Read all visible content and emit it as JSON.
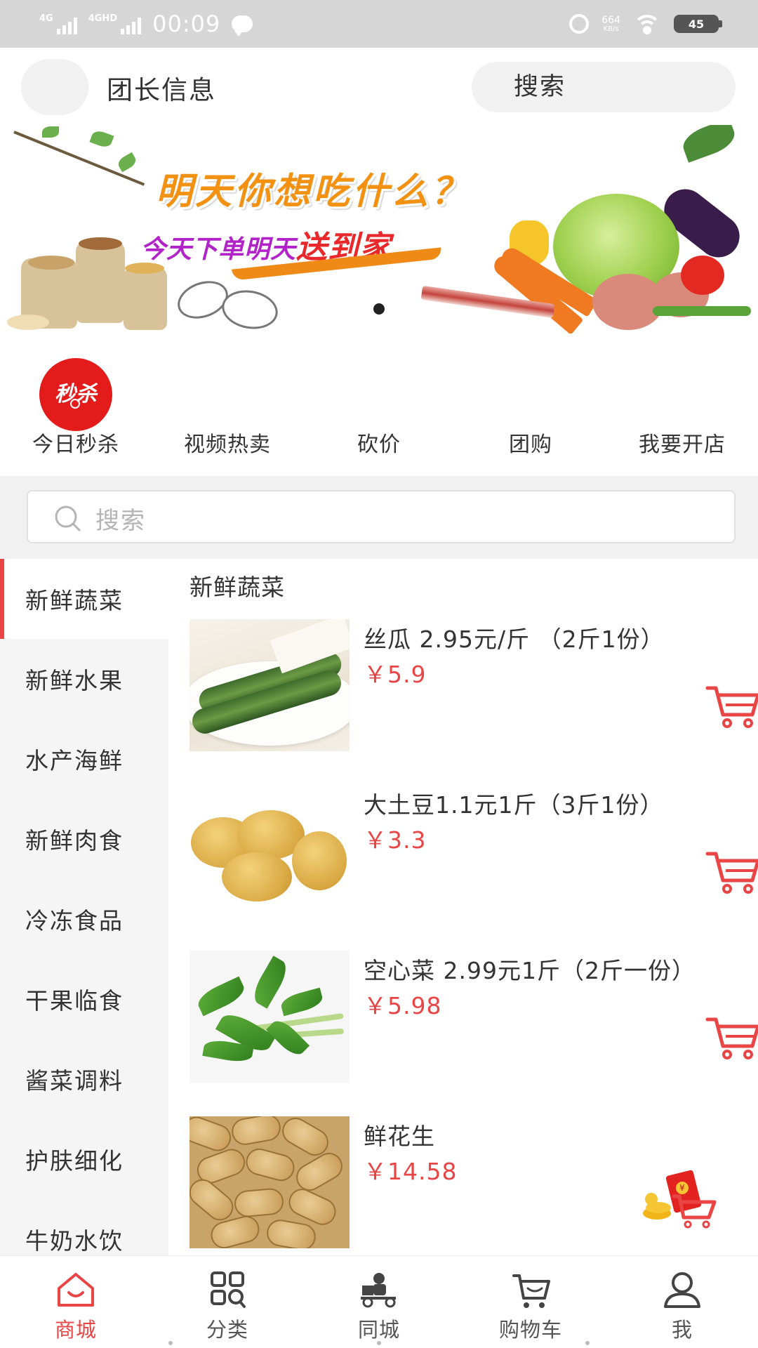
{
  "status_bar": {
    "network1": "4G",
    "network2": "4GHD",
    "time": "00:09",
    "speed_value": "664",
    "speed_unit": "KB/s",
    "battery": "45"
  },
  "header": {
    "leader_info": "团长信息",
    "search_label": "搜索"
  },
  "banner": {
    "title": "明天你想吃什么？",
    "subtitle_part1": "今天下单明天",
    "subtitle_part2": "送到家",
    "active_slide": 1,
    "slide_count": 1
  },
  "quick_nav": {
    "badge_text": "秒杀",
    "items": [
      {
        "label": "今日秒杀"
      },
      {
        "label": "视频热卖"
      },
      {
        "label": "砍价"
      },
      {
        "label": "团购"
      },
      {
        "label": "我要开店"
      }
    ]
  },
  "search": {
    "placeholder": "搜索"
  },
  "categories": [
    {
      "label": "新鲜蔬菜",
      "active": true
    },
    {
      "label": "新鲜水果"
    },
    {
      "label": "水产海鲜"
    },
    {
      "label": "新鲜肉食"
    },
    {
      "label": "冷冻食品"
    },
    {
      "label": "干果临食"
    },
    {
      "label": "酱菜调料"
    },
    {
      "label": "护肤细化"
    },
    {
      "label": "牛奶水饮"
    }
  ],
  "product_section": {
    "title": "新鲜蔬菜",
    "products": [
      {
        "name": "丝瓜 2.95元/斤 （2斤1份）",
        "price": "￥5.9",
        "image_icon": "luffa-image"
      },
      {
        "name": "大土豆1.1元1斤（3斤1份）",
        "price": "￥3.3",
        "image_icon": "potato-image"
      },
      {
        "name": "空心菜 2.99元1斤（2斤一份）",
        "price": "￥5.98",
        "image_icon": "water-spinach-image"
      },
      {
        "name": "鲜花生",
        "price": "￥14.58",
        "image_icon": "peanut-image"
      }
    ]
  },
  "tabbar": {
    "tabs": [
      {
        "label": "商城",
        "icon": "home-icon",
        "active": true
      },
      {
        "label": "分类",
        "icon": "category-icon"
      },
      {
        "label": "同城",
        "icon": "delivery-icon"
      },
      {
        "label": "购物车",
        "icon": "cart-icon"
      },
      {
        "label": "我",
        "icon": "user-icon"
      }
    ]
  },
  "colors": {
    "accent": "#e94545",
    "sidebar_bg": "#f5f5f5",
    "status_bar_bg": "#d6d6d6"
  }
}
